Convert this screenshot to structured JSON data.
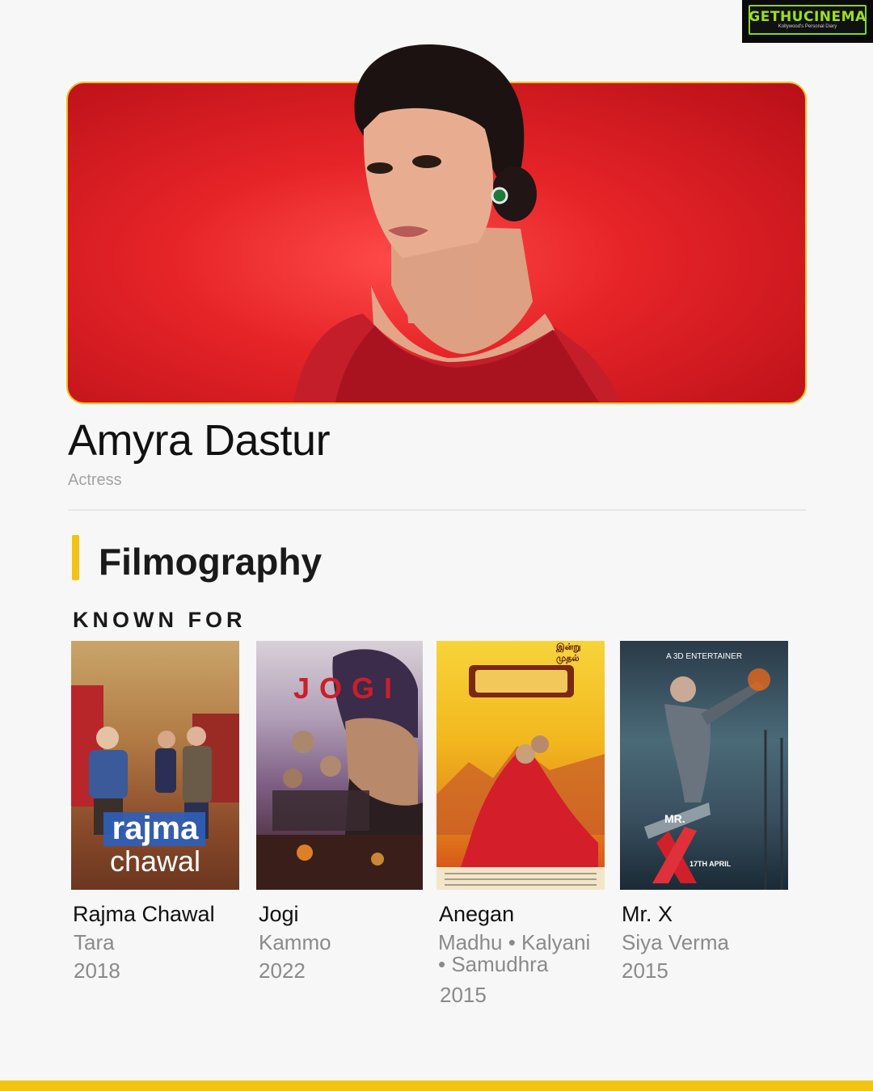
{
  "watermark": {
    "brand": "GETHUCINEMA",
    "tagline": "Kollywood's Personal Diary"
  },
  "profile": {
    "name": "Amyra Dastur",
    "role": "Actress"
  },
  "section": {
    "title": "Filmography",
    "subtitle": "KNOWN FOR"
  },
  "films": [
    {
      "title": "Rajma Chawal",
      "role": "Tara",
      "year": "2018",
      "poster_text_1": "rajma",
      "poster_text_2": "chawal"
    },
    {
      "title": "Jogi",
      "role": "Kammo",
      "year": "2022",
      "poster_text": "JOGI"
    },
    {
      "title": "Anegan",
      "role_line1": "Madhu • Kalyani",
      "role_line2": "• Samudhra",
      "year": "2015",
      "poster_top": "இன்று முதல்"
    },
    {
      "title": "Mr. X",
      "role": "Siya Verma",
      "year": "2015",
      "poster_top": "A 3D ENTERTAINER",
      "poster_date": "17TH APRIL",
      "poster_logo": "MR."
    }
  ],
  "colors": {
    "accent": "#f2c314",
    "hero_red": "#e62428",
    "background": "#f7f7f7",
    "muted_text": "#8a8a8a"
  }
}
